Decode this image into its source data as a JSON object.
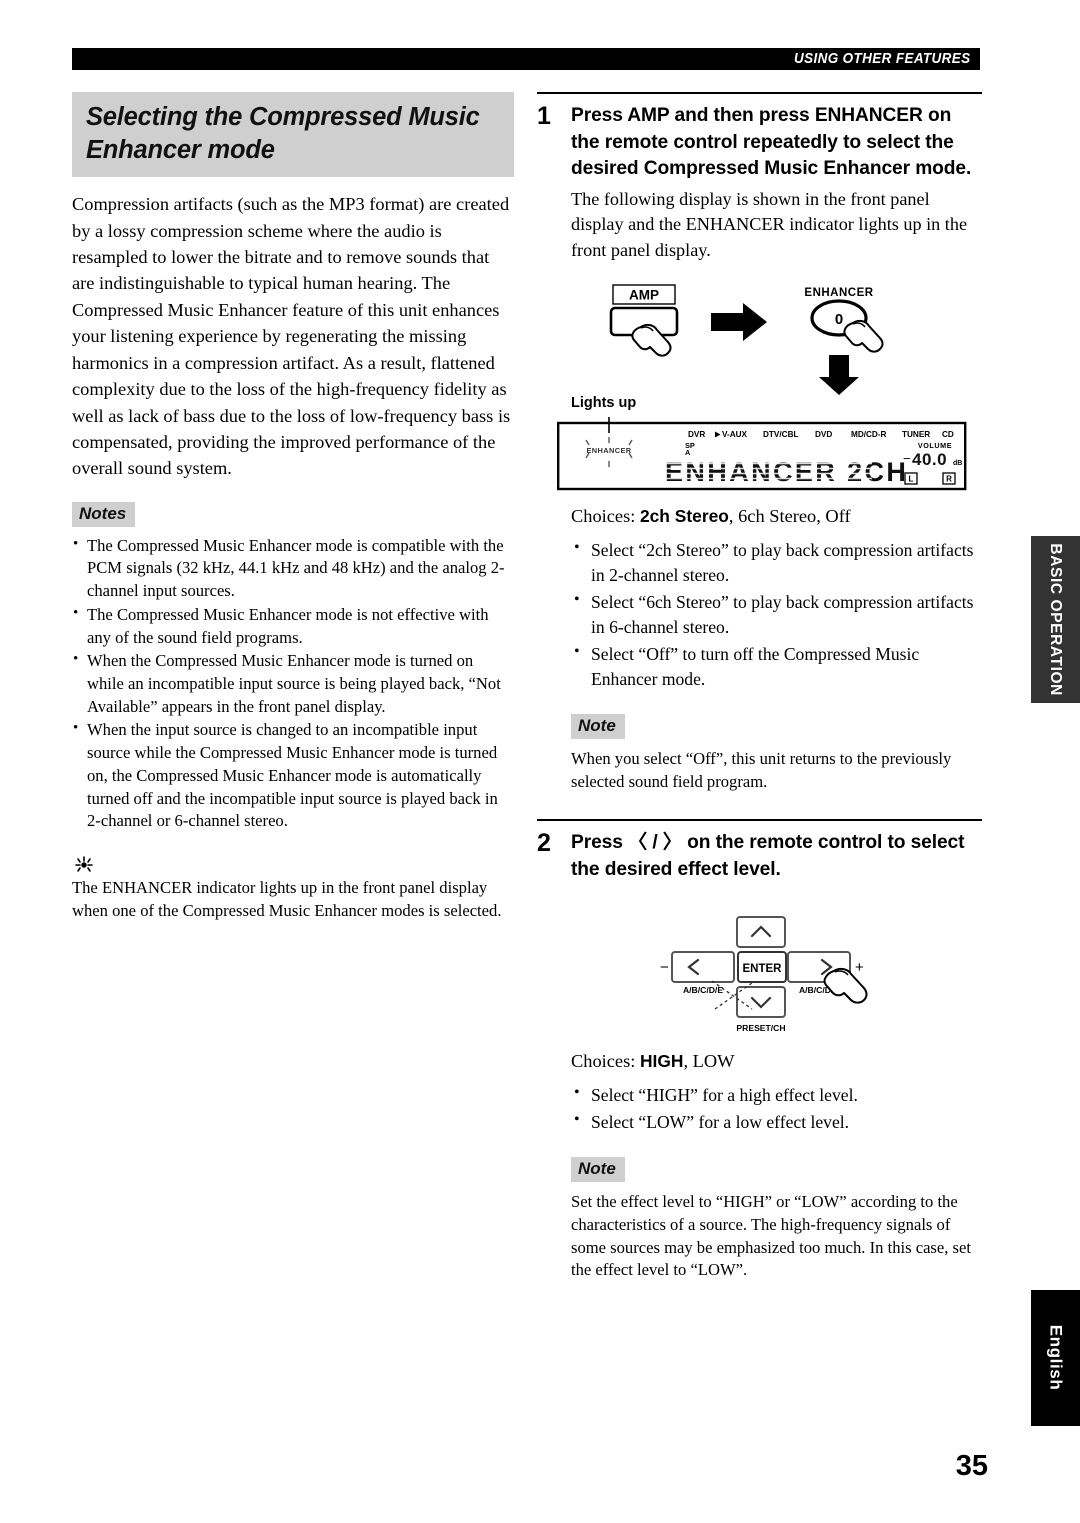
{
  "header": {
    "running_head": "USING OTHER FEATURES"
  },
  "left_column": {
    "section_title": "Selecting the Compressed Music Enhancer mode",
    "intro_paragraph": "Compression artifacts (such as the MP3 format) are created by a lossy compression scheme where the audio is resampled to lower the bitrate and to remove sounds that are indistinguishable to typical human hearing. The Compressed Music Enhancer feature of this unit enhances your listening experience by regenerating the missing harmonics in a compression artifact. As a result, flattened complexity due to the loss of the high-frequency fidelity as well as lack of bass due to the loss of low-frequency bass is compensated, providing the improved performance of the overall sound system.",
    "notes_heading": "Notes",
    "notes": [
      "The Compressed Music Enhancer mode is compatible with the PCM signals (32 kHz, 44.1 kHz and 48 kHz) and the analog 2-channel input sources.",
      "The Compressed Music Enhancer mode is not effective with any of the sound field programs.",
      "When the Compressed Music Enhancer mode is turned on while an incompatible input source is being played back, “Not Available” appears in the front panel display.",
      "When the input source is changed to an incompatible input source while the Compressed Music Enhancer mode is turned on, the Compressed Music Enhancer mode is automatically turned off and the incompatible input source is played back in 2-channel or 6-channel stereo."
    ],
    "tip_icon": "tip-sun-icon",
    "tip_text": "The ENHANCER indicator lights up in the front panel display when one of the Compressed Music Enhancer modes is selected."
  },
  "right_column": {
    "step1": {
      "number": "1",
      "title": "Press AMP and then press ENHANCER on the remote control repeatedly to select the desired Compressed Music Enhancer mode.",
      "body": "The following display is shown in the front panel display and the ENHANCER indicator lights up in the front panel display.",
      "diagram": {
        "amp_button_label": "AMP",
        "enhancer_label": "ENHANCER",
        "enhancer_button_label": "0",
        "arrow_right": "right-arrow-icon",
        "arrow_down": "down-arrow-icon",
        "hand_icon": "pointing-hand-icon"
      },
      "lcd": {
        "lights_up_label": "Lights up",
        "enhancer_indicator": "ENHANCER",
        "input_labels": [
          "DVR",
          "V-AUX",
          "DTV/CBL",
          "DVD",
          "MD/CD-R",
          "TUNER",
          "CD"
        ],
        "selected_input": "V-AUX",
        "speaker_label_top": "SP",
        "speaker_label_bottom": "A",
        "main_text": "ENHANCER 2CH",
        "volume_label": "VOLUME",
        "volume_sign": "−",
        "volume_value": "40.0",
        "volume_unit": "dB",
        "channel_left": "L",
        "channel_right": "R"
      },
      "choices_prefix": "Choices:",
      "choices_bold": "2ch Stereo",
      "choices_rest": ", 6ch Stereo, Off",
      "choice_bullets": [
        "Select “2ch Stereo” to play back compression artifacts in 2-channel stereo.",
        "Select “6ch Stereo” to play back compression artifacts in 6-channel stereo.",
        "Select “Off” to turn off the Compressed Music Enhancer mode."
      ],
      "note_heading": "Note",
      "note_text": "When you select “Off”, this unit returns to the previously selected sound field program."
    },
    "step2": {
      "number": "2",
      "title": "Press 〈 / 〉 on the remote control to select the desired effect level.",
      "diagram": {
        "enter_label": "ENTER",
        "left_label": "A/B/C/D/E",
        "right_label": "A/B/C/D/E",
        "bottom_label": "PRESET/CH",
        "minus_label": "−",
        "plus_label": "+",
        "up_arrow": "up-arrow-icon",
        "down_arrow": "down-arrow-icon",
        "left_arrow": "left-arrow-icon",
        "right_arrow": "right-arrow-icon",
        "hand_icon": "pointing-hand-icon"
      },
      "choices_prefix": "Choices:",
      "choices_bold": "HIGH",
      "choices_rest": ", LOW",
      "choice_bullets": [
        "Select “HIGH” for a high effect level.",
        "Select “LOW” for a low effect level."
      ],
      "note_heading": "Note",
      "note_text": "Set the effect level to “HIGH” or “LOW” according to the characteristics of a source. The high-frequency signals of some sources may be emphasized too much. In this case, set the effect level to “LOW”."
    }
  },
  "side_tabs": {
    "basic_operation": "BASIC OPERATION",
    "english": "English"
  },
  "page_number": "35",
  "colors": {
    "chip_gray": "#cfcfcf",
    "tab_gray": "#333333",
    "tab_black": "#000000",
    "ink": "#000000"
  }
}
